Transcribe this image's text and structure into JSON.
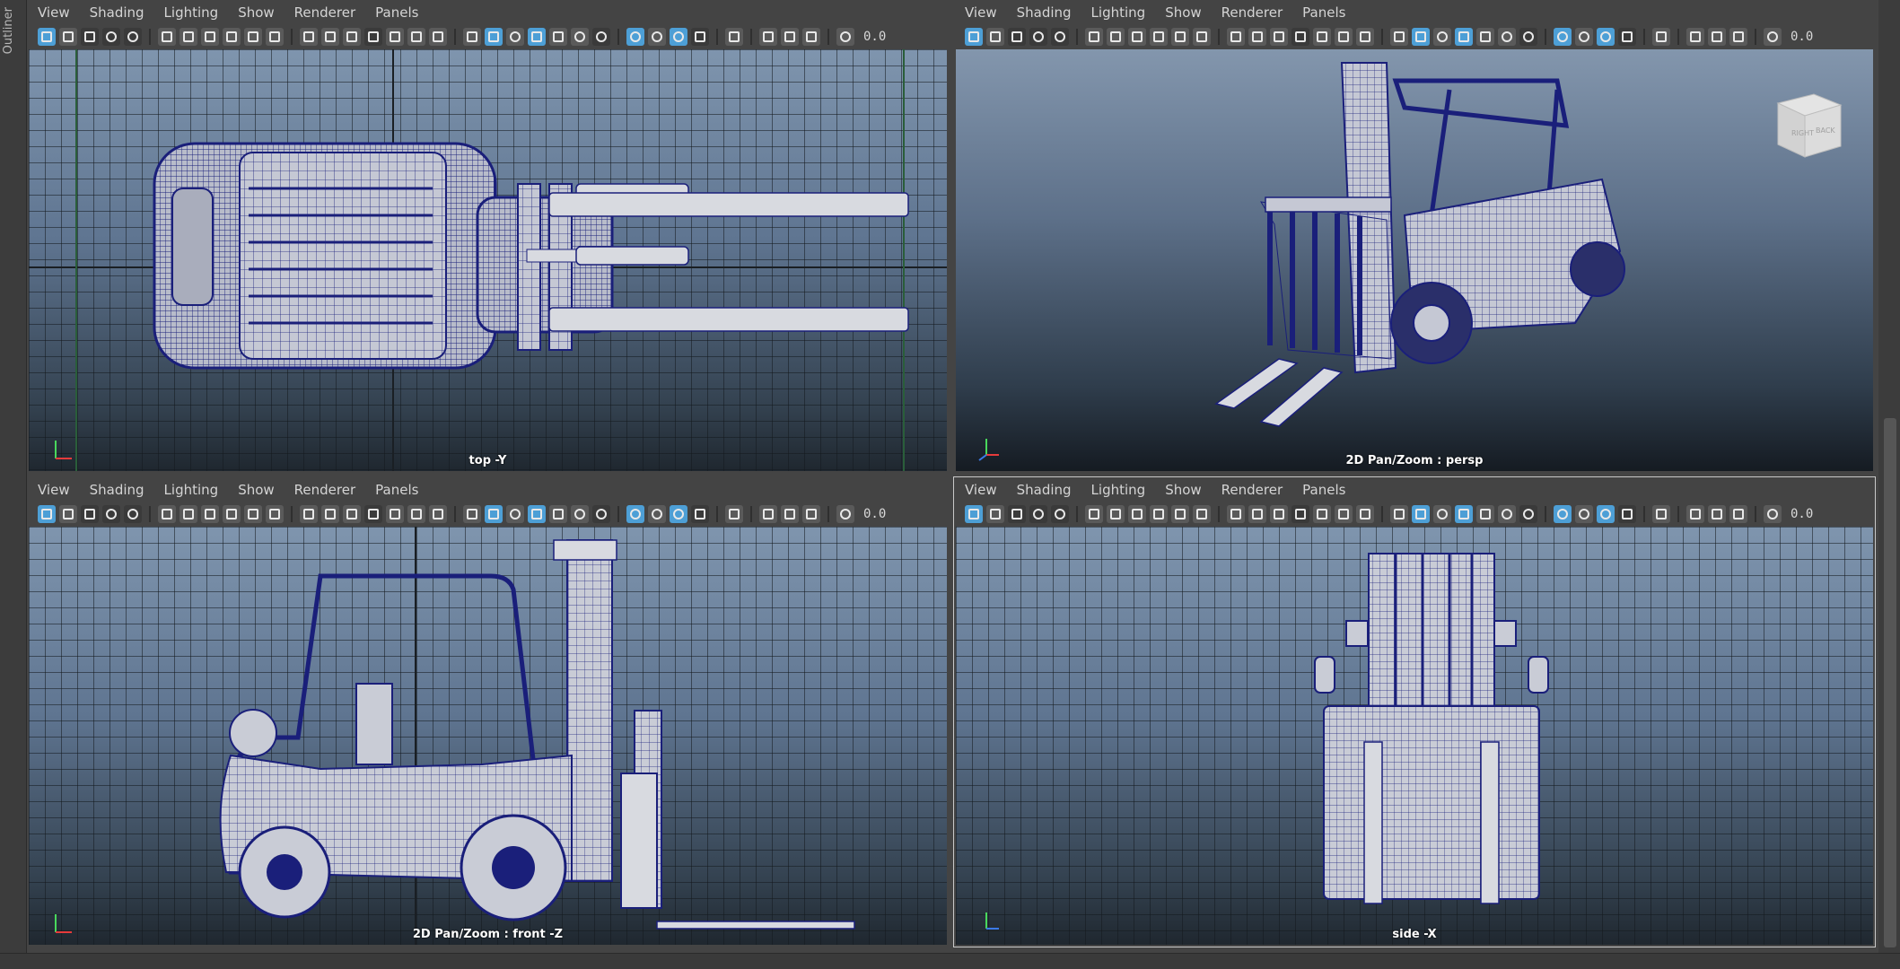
{
  "outliner": {
    "label": "Outliner"
  },
  "menus": [
    "View",
    "Shading",
    "Lighting",
    "Show",
    "Renderer",
    "Panels"
  ],
  "toolbar_value": "0.0",
  "viewports": {
    "top": {
      "camera_label": "top -Y"
    },
    "persp": {
      "camera_label": "2D Pan/Zoom : persp"
    },
    "front": {
      "camera_label": "2D Pan/Zoom : front -Z"
    },
    "side": {
      "camera_label": "side -X"
    }
  },
  "viewcube": {
    "face_right": "RIGHT",
    "face_back": "BACK"
  },
  "axis_labels": {
    "x": "x",
    "y": "y"
  },
  "colors": {
    "accent": "#4d9fd6",
    "wire": "#1a1f7a",
    "mesh_fill": "#c9ccd6",
    "panel_bg": "#444444"
  }
}
